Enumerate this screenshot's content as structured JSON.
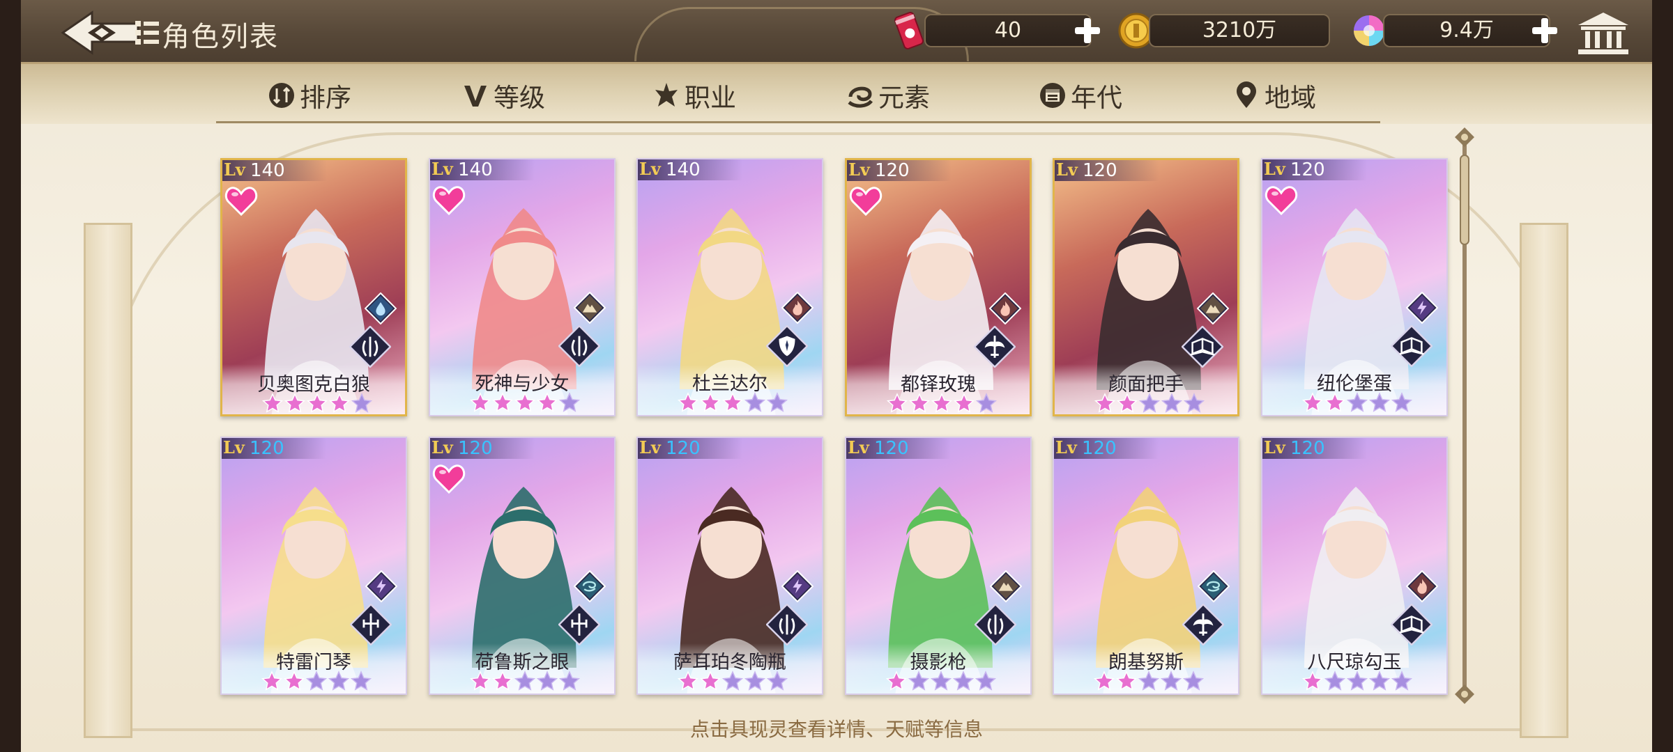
{
  "header": {
    "title": "角色列表",
    "resources": [
      {
        "name": "stamina-drink",
        "icon": "red-can-icon",
        "value": "40"
      },
      {
        "name": "gold",
        "icon": "gold-coin-icon",
        "value": "3210万"
      },
      {
        "name": "gems",
        "icon": "rainbow-gem-icon",
        "value": "9.4万"
      }
    ]
  },
  "tabs": [
    {
      "label": "排序",
      "icon": "sort-icon"
    },
    {
      "label": "等级",
      "icon": "level-v-icon"
    },
    {
      "label": "职业",
      "icon": "class-icon"
    },
    {
      "label": "元素",
      "icon": "element-swirl-icon"
    },
    {
      "label": "年代",
      "icon": "era-calendar-icon"
    },
    {
      "label": "地域",
      "icon": "region-pin-icon"
    }
  ],
  "cards": [
    {
      "lv_label": "Lv",
      "lv": "140",
      "name": "贝奥图克白狼",
      "stars": 4,
      "max_stars": 5,
      "favorite": true,
      "element": "water",
      "class": "triple-claw",
      "rarity": "gold",
      "lv_color": "white"
    },
    {
      "lv_label": "Lv",
      "lv": "140",
      "name": "死神与少女",
      "stars": 4,
      "max_stars": 5,
      "favorite": true,
      "element": "earth",
      "class": "triple-claw",
      "rarity": "purple",
      "lv_color": "white"
    },
    {
      "lv_label": "Lv",
      "lv": "140",
      "name": "杜兰达尔",
      "stars": 3,
      "max_stars": 5,
      "favorite": false,
      "element": "fire",
      "class": "shield",
      "rarity": "purple",
      "lv_color": "white"
    },
    {
      "lv_label": "Lv",
      "lv": "120",
      "name": "都铎玫瑰",
      "stars": 4,
      "max_stars": 5,
      "favorite": true,
      "element": "fire",
      "class": "winged-sword",
      "rarity": "gold",
      "lv_color": "white"
    },
    {
      "lv_label": "Lv",
      "lv": "120",
      "name": "颜面把手",
      "stars": 2,
      "max_stars": 5,
      "favorite": false,
      "element": "earth",
      "class": "book",
      "rarity": "gold",
      "lv_color": "white"
    },
    {
      "lv_label": "Lv",
      "lv": "120",
      "name": "纽伦堡蛋",
      "stars": 2,
      "max_stars": 5,
      "favorite": true,
      "element": "lightning",
      "class": "book",
      "rarity": "purple",
      "lv_color": "white"
    },
    {
      "lv_label": "Lv",
      "lv": "120",
      "name": "特雷门琴",
      "stars": 2,
      "max_stars": 5,
      "favorite": false,
      "element": "lightning",
      "class": "cross-sword",
      "rarity": "purple",
      "lv_color": "blue"
    },
    {
      "lv_label": "Lv",
      "lv": "120",
      "name": "荷鲁斯之眼",
      "stars": 2,
      "max_stars": 5,
      "favorite": true,
      "element": "wind",
      "class": "cross-sword",
      "rarity": "purple",
      "lv_color": "blue"
    },
    {
      "lv_label": "Lv",
      "lv": "120",
      "name": "萨耳珀冬陶瓶",
      "stars": 2,
      "max_stars": 5,
      "favorite": false,
      "element": "lightning",
      "class": "triple-claw",
      "rarity": "purple",
      "lv_color": "blue"
    },
    {
      "lv_label": "Lv",
      "lv": "120",
      "name": "摄影枪",
      "stars": 1,
      "max_stars": 5,
      "favorite": false,
      "element": "earth",
      "class": "triple-claw",
      "rarity": "purple",
      "lv_color": "blue"
    },
    {
      "lv_label": "Lv",
      "lv": "120",
      "name": "朗基努斯",
      "stars": 2,
      "max_stars": 5,
      "favorite": false,
      "element": "wind",
      "class": "winged-sword",
      "rarity": "purple",
      "lv_color": "blue"
    },
    {
      "lv_label": "Lv",
      "lv": "120",
      "name": "八尺琼勾玉",
      "stars": 1,
      "max_stars": 5,
      "favorite": false,
      "element": "fire",
      "class": "book",
      "rarity": "purple",
      "lv_color": "blue"
    }
  ],
  "footer_hint": "点击具现灵查看详情、天赋等信息",
  "colors": {
    "topbar": "#574838",
    "tabbar": "#ddd0b0",
    "star_filled": "#e86fd0",
    "star_empty": "#a78ee0",
    "level_gold": "#f2cb54",
    "level_blue": "#39c3ff",
    "hint_text": "#8a6b42"
  }
}
